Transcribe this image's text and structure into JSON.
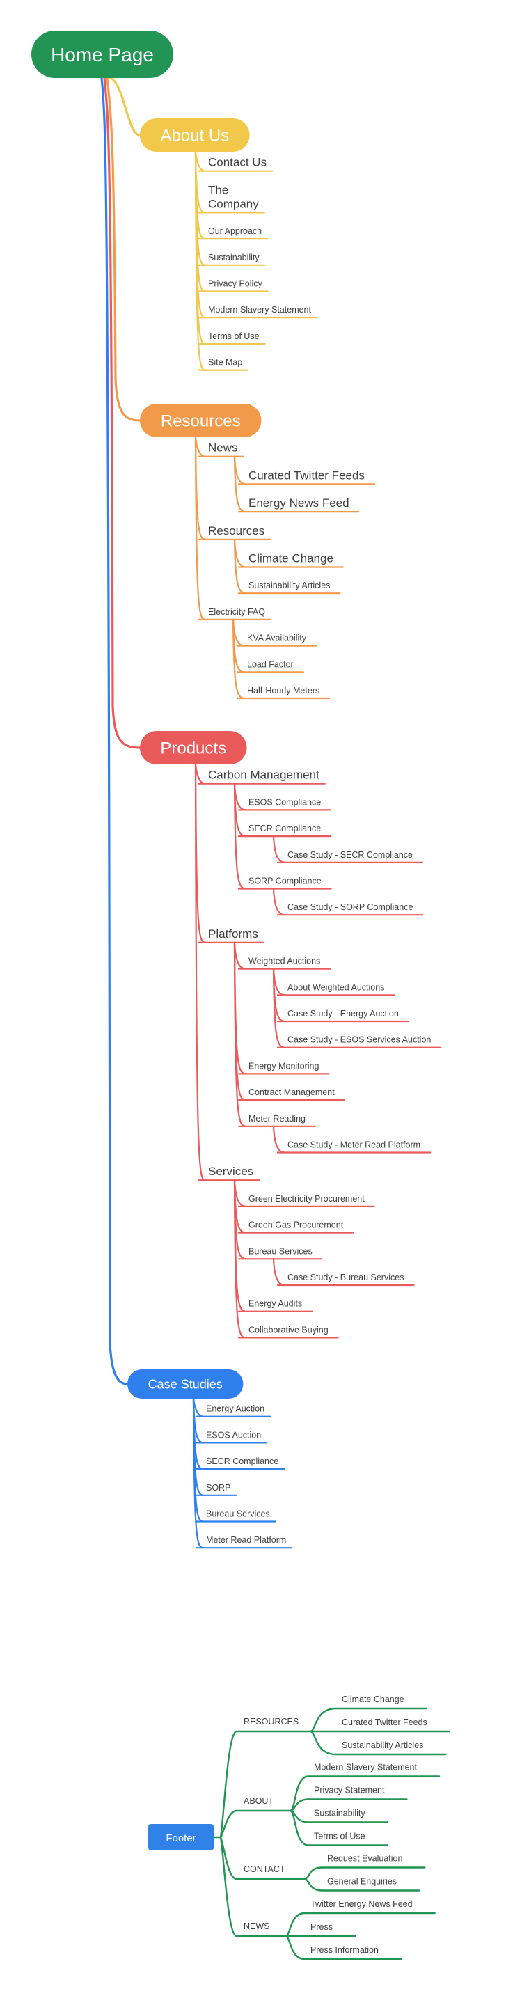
{
  "colors": {
    "home": "#229453",
    "about": "#F2C84B",
    "resources": "#F29A4A",
    "products": "#EB5A5A",
    "case_studies": "#2F80ED",
    "footer_box": "#3182E8",
    "footer_lines": "#229453",
    "text": "#404040"
  },
  "root": {
    "label": "Home Page"
  },
  "branches": [
    {
      "id": "about",
      "label": "About Us",
      "color_key": "about",
      "children": [
        {
          "label": "Contact Us",
          "size": "md"
        },
        {
          "label": "The Company",
          "lines": [
            "The",
            "Company"
          ],
          "size": "md"
        },
        {
          "label": "Our Approach"
        },
        {
          "label": "Sustainability"
        },
        {
          "label": "Privacy Policy"
        },
        {
          "label": "Modern Slavery Statement"
        },
        {
          "label": "Terms of Use"
        },
        {
          "label": "Site Map"
        }
      ]
    },
    {
      "id": "resources",
      "label": "Resources",
      "color_key": "resources",
      "children": [
        {
          "label": "News",
          "size": "md",
          "children": [
            {
              "label": "Curated Twitter Feeds",
              "size": "md"
            },
            {
              "label": "Energy News Feed",
              "size": "md"
            }
          ]
        },
        {
          "label": "Resources",
          "size": "md",
          "children": [
            {
              "label": "Climate Change",
              "size": "md"
            },
            {
              "label": "Sustainability Articles"
            }
          ]
        },
        {
          "label": "Electricity FAQ",
          "children": [
            {
              "label": "KVA Availability"
            },
            {
              "label": "Load Factor"
            },
            {
              "label": "Half-Hourly Meters"
            }
          ]
        }
      ]
    },
    {
      "id": "products",
      "label": "Products",
      "color_key": "products",
      "children": [
        {
          "label": "Carbon Management",
          "size": "md",
          "children": [
            {
              "label": "ESOS Compliance"
            },
            {
              "label": "SECR Compliance",
              "children": [
                {
                  "label": "Case Study - SECR Compliance"
                }
              ]
            },
            {
              "label": "SORP Compliance",
              "children": [
                {
                  "label": "Case Study - SORP Compliance"
                }
              ]
            }
          ]
        },
        {
          "label": "Platforms",
          "size": "md",
          "children": [
            {
              "label": "Weighted Auctions",
              "children": [
                {
                  "label": "About Weighted Auctions"
                },
                {
                  "label": "Case Study - Energy Auction"
                },
                {
                  "label": "Case Study - ESOS Services Auction"
                }
              ]
            },
            {
              "label": "Energy Monitoring"
            },
            {
              "label": "Contract Management"
            },
            {
              "label": "Meter Reading",
              "children": [
                {
                  "label": "Case Study - Meter Read Platform"
                }
              ]
            }
          ]
        },
        {
          "label": "Services",
          "size": "md",
          "children": [
            {
              "label": "Green Electricity Procurement"
            },
            {
              "label": "Green Gas Procurement"
            },
            {
              "label": "Bureau Services",
              "children": [
                {
                  "label": "Case Study - Bureau Services"
                }
              ]
            },
            {
              "label": "Energy Audits"
            },
            {
              "label": "Collaborative Buying"
            }
          ]
        }
      ]
    },
    {
      "id": "case_studies",
      "label": "Case Studies",
      "color_key": "case_studies",
      "children": [
        {
          "label": "Energy Auction"
        },
        {
          "label": "ESOS Auction"
        },
        {
          "label": "SECR Compliance"
        },
        {
          "label": "SORP"
        },
        {
          "label": "Bureau Services"
        },
        {
          "label": "Meter Read Platform"
        }
      ]
    }
  ],
  "footer": {
    "label": "Footer",
    "groups": [
      {
        "label": "RESOURCES",
        "items": [
          "Climate Change",
          "Curated Twitter Feeds",
          "Sustainability Articles"
        ]
      },
      {
        "label": "ABOUT",
        "items": [
          "Modern Slavery Statement",
          "Privacy Statement",
          "Sustainability",
          "Terms of Use"
        ]
      },
      {
        "label": "CONTACT",
        "items": [
          "Request Evaluation",
          "General Enquiries"
        ]
      },
      {
        "label": "NEWS",
        "items": [
          "Twitter Energy News Feed",
          "Press",
          "Press Information"
        ]
      }
    ]
  }
}
